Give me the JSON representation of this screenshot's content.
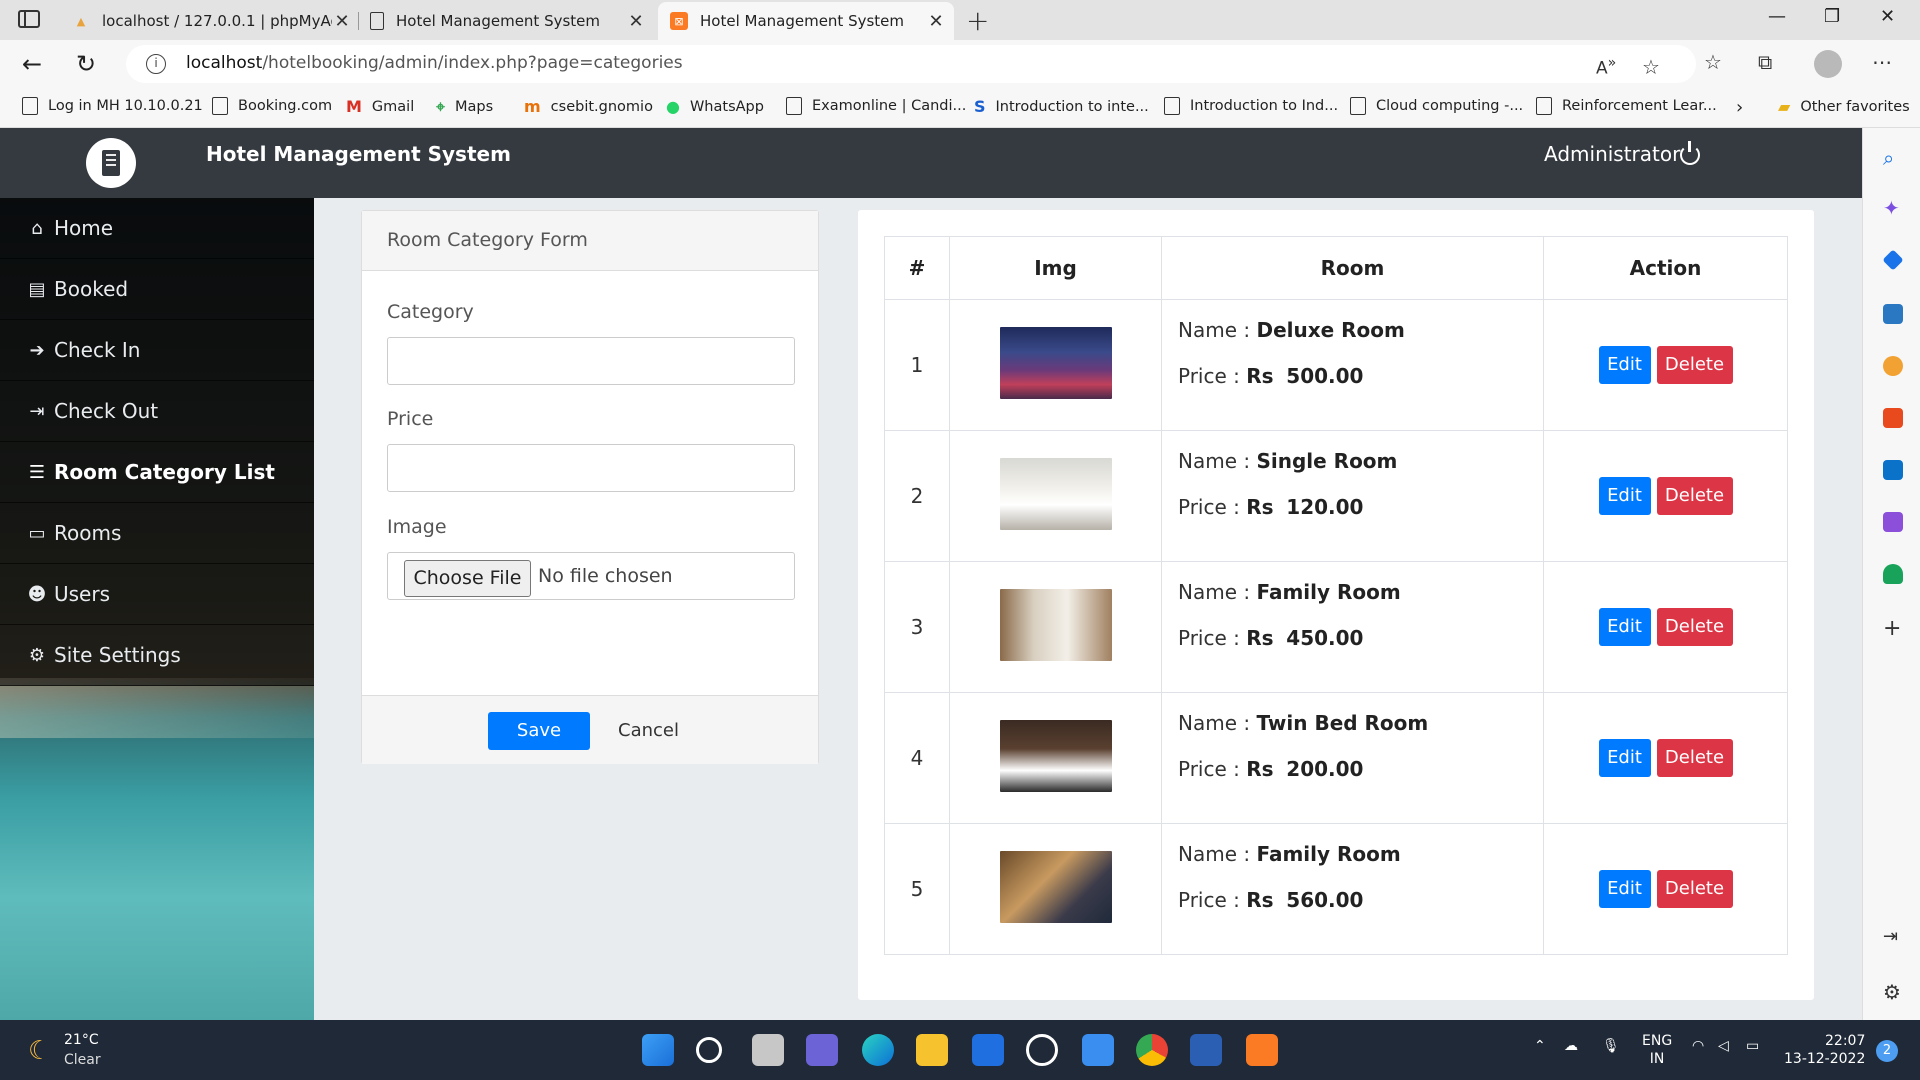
{
  "browser": {
    "tabs": [
      {
        "title": "localhost / 127.0.0.1 | phpMyAdmin",
        "favicon": "phpmyadmin-icon"
      },
      {
        "title": "Hotel Management System",
        "favicon": "page-icon"
      },
      {
        "title": "Hotel Management System",
        "favicon": "xampp-icon"
      }
    ],
    "url_host": "localhost",
    "url_path": "/hotelbooking/admin/index.php?page=categories",
    "bookmarks": [
      "Log in MH 10.10.0.21",
      "Booking.com",
      "Gmail",
      "Maps",
      "csebit.gnomio",
      "WhatsApp",
      "Examonline | Candi...",
      "Introduction to inte...",
      "Introduction to Ind...",
      "Cloud computing -...",
      "Reinforcement Lear..."
    ],
    "other_favorites": "Other favorites"
  },
  "app": {
    "title": "Hotel Management System",
    "user": "Administrator"
  },
  "sidebar": {
    "items": [
      {
        "label": "Home",
        "icon": "home-icon"
      },
      {
        "label": "Booked",
        "icon": "book-icon"
      },
      {
        "label": "Check In",
        "icon": "sign-in-icon"
      },
      {
        "label": "Check Out",
        "icon": "sign-out-icon"
      },
      {
        "label": "Room Category List",
        "icon": "list-icon"
      },
      {
        "label": "Rooms",
        "icon": "bed-icon"
      },
      {
        "label": "Users",
        "icon": "users-icon"
      },
      {
        "label": "Site Settings",
        "icon": "cogs-icon"
      }
    ],
    "active_index": 4
  },
  "form": {
    "header": "Room Category Form",
    "category_label": "Category",
    "price_label": "Price",
    "image_label": "Image",
    "choose_file": "Choose File",
    "no_file": "No file chosen",
    "save": "Save",
    "cancel": "Cancel"
  },
  "table": {
    "headers": [
      "#",
      "Img",
      "Room",
      "Action"
    ],
    "name_label": "Name :",
    "price_label": "Price :",
    "currency": "Rs",
    "edit": "Edit",
    "delete": "Delete",
    "rows": [
      {
        "num": "1",
        "name": "Deluxe Room",
        "price": "500.00"
      },
      {
        "num": "2",
        "name": "Single Room",
        "price": "120.00"
      },
      {
        "num": "3",
        "name": "Family Room",
        "price": "450.00"
      },
      {
        "num": "4",
        "name": "Twin Bed Room",
        "price": "200.00"
      },
      {
        "num": "5",
        "name": "Family Room",
        "price": "560.00"
      }
    ]
  },
  "taskbar": {
    "temp": "21°C",
    "weather": "Clear",
    "lang1": "ENG",
    "lang2": "IN",
    "time": "22:07",
    "date": "13-12-2022",
    "notifications": "2"
  },
  "colors": {
    "header_bg": "#343a40",
    "primary": "#007bff",
    "danger": "#dc3545"
  }
}
